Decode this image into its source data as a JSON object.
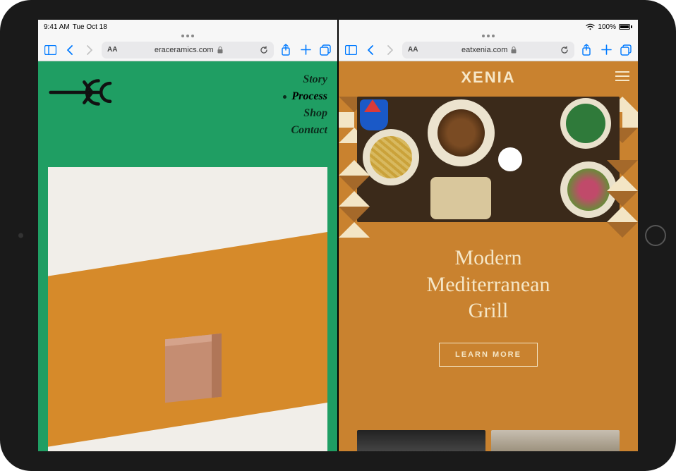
{
  "status": {
    "time": "9:41 AM",
    "date": "Tue Oct 18",
    "battery_pct": "100%"
  },
  "panes": {
    "left": {
      "url": "eraceramics.com",
      "nav": {
        "items": [
          {
            "label": "Story",
            "active": false
          },
          {
            "label": "Process",
            "active": true
          },
          {
            "label": "Shop",
            "active": false
          },
          {
            "label": "Contact",
            "active": false
          }
        ]
      }
    },
    "right": {
      "url": "eatxenia.com",
      "brand": "XENIA",
      "tagline_l1": "Modern",
      "tagline_l2": "Mediterranean",
      "tagline_l3": "Grill",
      "cta": "LEARN MORE"
    }
  },
  "toolbar_icons": {
    "sidebar": "sidebar-icon",
    "back": "chevron-left-icon",
    "forward": "chevron-right-icon",
    "aa": "AA",
    "lock": "lock-icon",
    "reload": "reload-icon",
    "share": "share-icon",
    "add": "plus-icon",
    "tabs": "tabs-icon"
  }
}
